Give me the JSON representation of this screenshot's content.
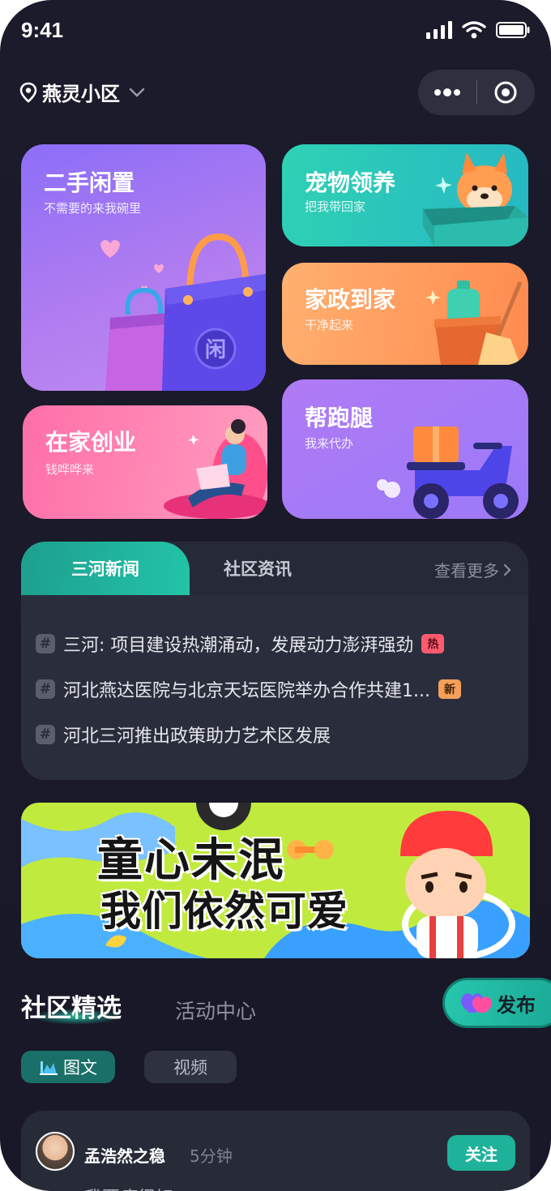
{
  "status_bar": {
    "time": "9:41"
  },
  "header": {
    "location": "燕灵小区"
  },
  "cards": {
    "secondhand": {
      "title": "二手闲置",
      "subtitle": "不需要的来我碗里",
      "bag_label": "闲"
    },
    "pet": {
      "title": "宠物领养",
      "subtitle": "把我带回家"
    },
    "housekeeping": {
      "title": "家政到家",
      "subtitle": "干净起来"
    },
    "startup": {
      "title": "在家创业",
      "subtitle": "钱哗哗来"
    },
    "errand": {
      "title": "帮跑腿",
      "subtitle": "我来代办"
    }
  },
  "news": {
    "tabs": [
      "三河新闻",
      "社区资讯"
    ],
    "active_tab": 0,
    "more_label": "查看更多",
    "items": [
      {
        "text": "三河: 项目建设热潮涌动，发展动力澎湃强劲",
        "badge": "热",
        "badge_color": "#ff5a6e"
      },
      {
        "text": "河北燕达医院与北京天坛医院举办合作共建1...",
        "badge": "新",
        "badge_color": "#f3a05a"
      },
      {
        "text": "河北三河推出政策助力艺术区发展",
        "badge": "",
        "badge_color": ""
      }
    ]
  },
  "banner": {
    "line1": "童心未泯",
    "line2": "我们依然可爱"
  },
  "feed": {
    "tabs": [
      "社区精选",
      "活动中心"
    ],
    "publish_label": "发布",
    "filters": [
      "图文",
      "视频"
    ],
    "post": {
      "user": "孟浩然之稳",
      "time": "5分钟",
      "follow_label": "关注",
      "preview": "我要瘦很好"
    }
  },
  "colors": {
    "accent": "#1fb29a",
    "bg": "#1b1b2b"
  }
}
